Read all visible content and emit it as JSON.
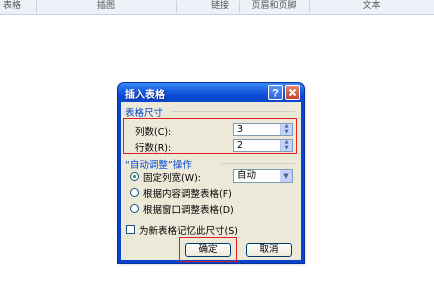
{
  "ribbon": {
    "groups": [
      "表格",
      "插图",
      "链接",
      "页眉和页脚",
      "文本"
    ]
  },
  "dialog": {
    "title": "插入表格",
    "table_size": {
      "label": "表格尺寸",
      "columns_label": "列数(C):",
      "columns_value": "3",
      "rows_label": "行数(R):",
      "rows_value": "2"
    },
    "autofit": {
      "label": "“自动调整”操作",
      "options": [
        {
          "label": "固定列宽(W):",
          "selected": true
        },
        {
          "label": "根据内容调整表格(F)",
          "selected": false
        },
        {
          "label": "根据窗口调整表格(D)",
          "selected": false
        }
      ],
      "fixed_width_value": "自动"
    },
    "remember_label": "为新表格记忆此尺寸(S)",
    "remember_checked": false,
    "ok_label": "确定",
    "cancel_label": "取消"
  },
  "colors": {
    "titlebar": "#0a49d6",
    "highlight": "#e02020",
    "section_label": "#0046d5"
  }
}
